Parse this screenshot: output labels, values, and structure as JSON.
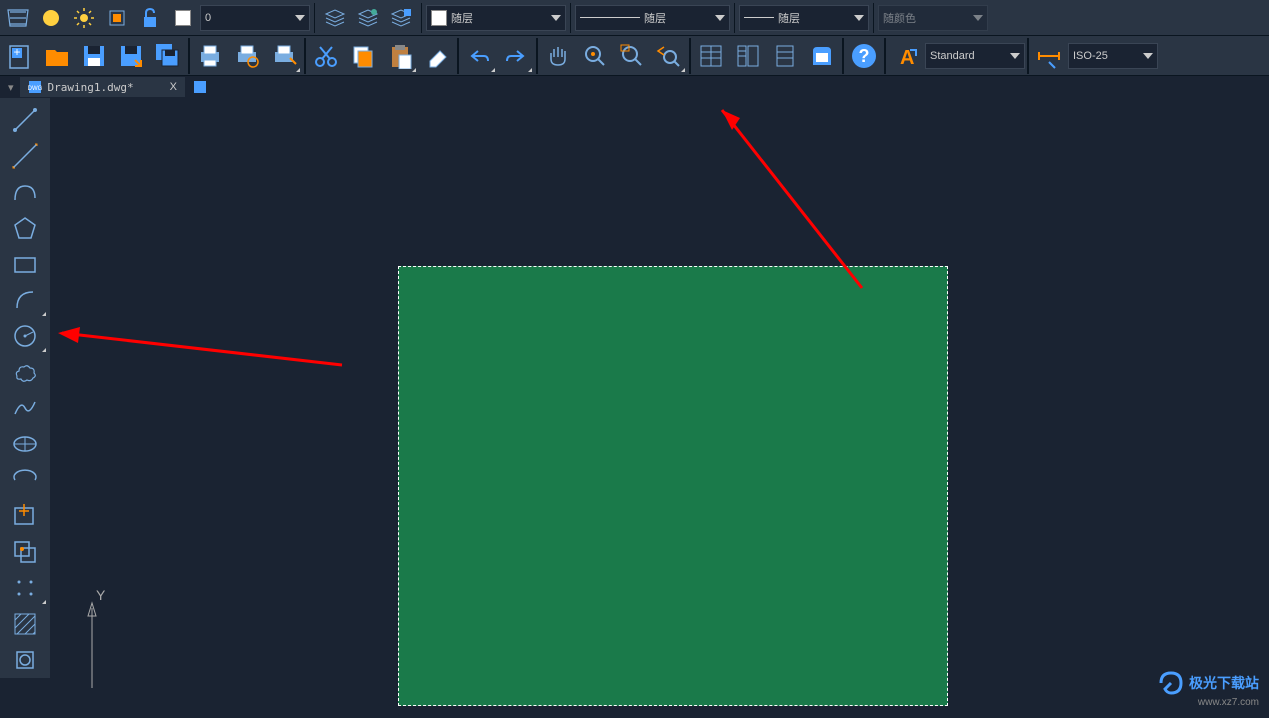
{
  "topbar": {
    "layer_number": "0",
    "color_label": "随层",
    "linetype_label": "随层",
    "lineweight_label": "随层",
    "plot_style_label": "随颜色"
  },
  "secondbar": {
    "text_style": "Standard",
    "dim_style": "ISO-25"
  },
  "tabs": {
    "active_file": "Drawing1.dwg*",
    "close_symbol": "X"
  },
  "watermark": {
    "title": "极光下载站",
    "url": "www.xz7.com"
  },
  "canvas": {
    "ucs_y": "Y"
  },
  "icons": {
    "layer1": "layer-freeze-icon",
    "layer2": "light-bulb-icon",
    "layer3": "layer-thaw-icon",
    "layer4": "rectangle-icon",
    "layer5": "unlock-icon"
  }
}
